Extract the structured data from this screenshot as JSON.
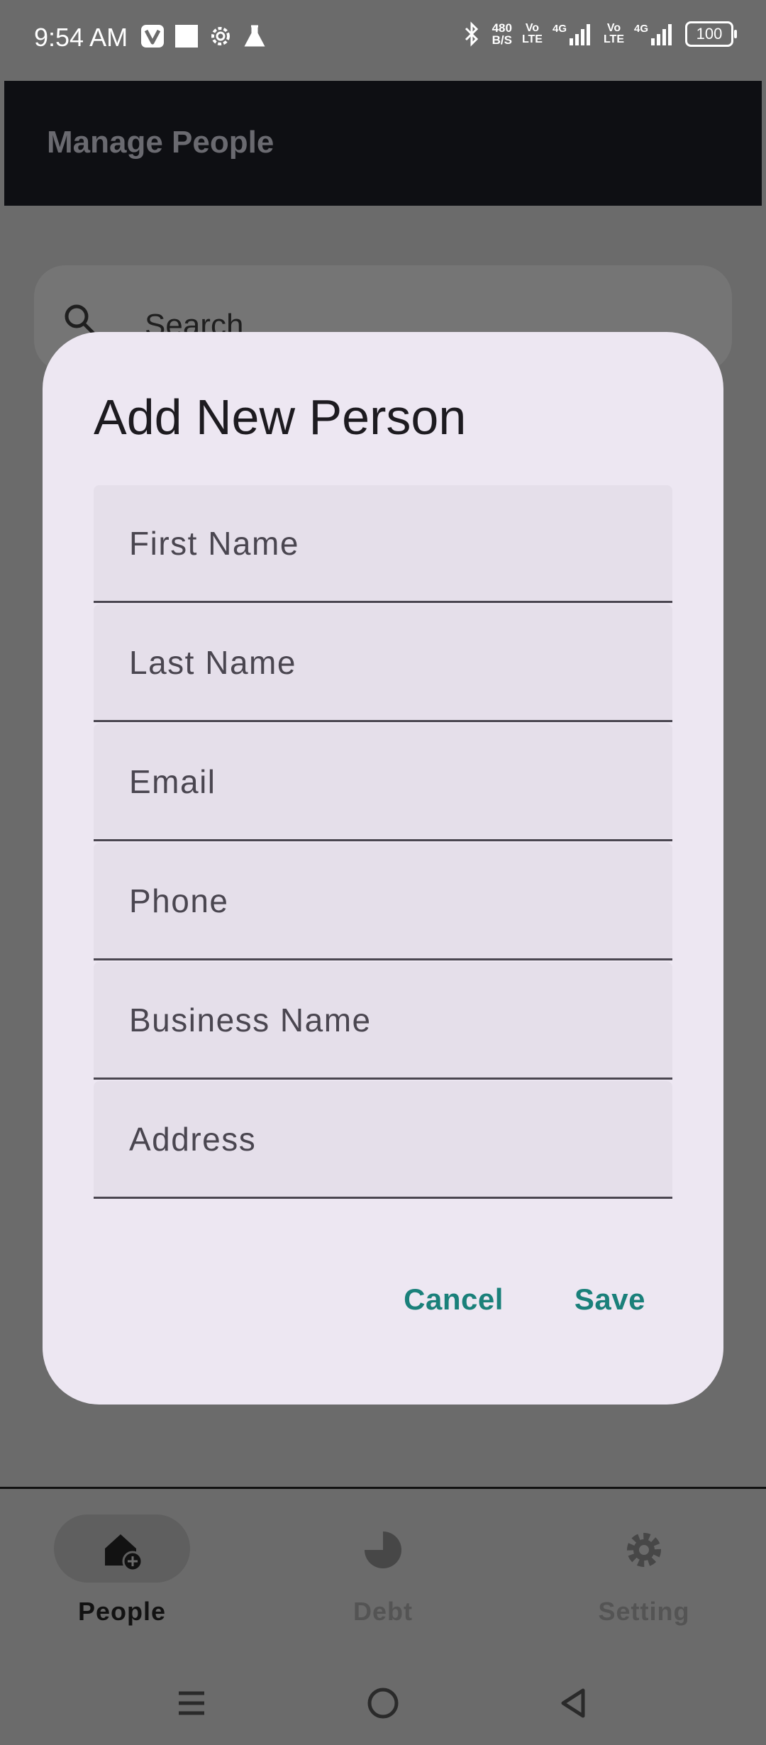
{
  "status_bar": {
    "time": "9:54 AM",
    "net_speed_value": "480",
    "net_speed_unit": "B/S",
    "sim1_tag": "Vo",
    "sim1_tag2": "LTE",
    "sim2_tag": "Vo",
    "sim2_tag2": "LTE",
    "battery": "100",
    "icons": [
      "vivaldi-icon",
      "square-notification-icon",
      "settings-gear-icon",
      "flask-icon",
      "bluetooth-icon",
      "signal-4g-icon",
      "signal-4g-icon"
    ]
  },
  "app_bar": {
    "title": "Manage People"
  },
  "search": {
    "placeholder": "Search"
  },
  "dialog": {
    "title": "Add New Person",
    "fields": [
      {
        "key": "first_name",
        "placeholder": "First Name",
        "value": ""
      },
      {
        "key": "last_name",
        "placeholder": "Last Name",
        "value": ""
      },
      {
        "key": "email",
        "placeholder": "Email",
        "value": ""
      },
      {
        "key": "phone",
        "placeholder": "Phone",
        "value": ""
      },
      {
        "key": "business_name",
        "placeholder": "Business Name",
        "value": ""
      },
      {
        "key": "address",
        "placeholder": "Address",
        "value": ""
      }
    ],
    "cancel_label": "Cancel",
    "save_label": "Save"
  },
  "bottom_nav": {
    "items": [
      {
        "label": "People",
        "icon": "home-add-icon",
        "active": true
      },
      {
        "label": "Debt",
        "icon": "pie-chart-icon",
        "active": false
      },
      {
        "label": "Setting",
        "icon": "gear-icon",
        "active": false
      }
    ]
  },
  "system_nav": {
    "buttons": [
      "menu-icon",
      "home-circle-icon",
      "back-triangle-icon"
    ]
  },
  "colors": {
    "scrim": "#6b6b6b",
    "app_bar": "#0e0f13",
    "dialog_bg": "#ede7f2",
    "field_bg": "#e5dfea",
    "accent": "#1a807a"
  }
}
